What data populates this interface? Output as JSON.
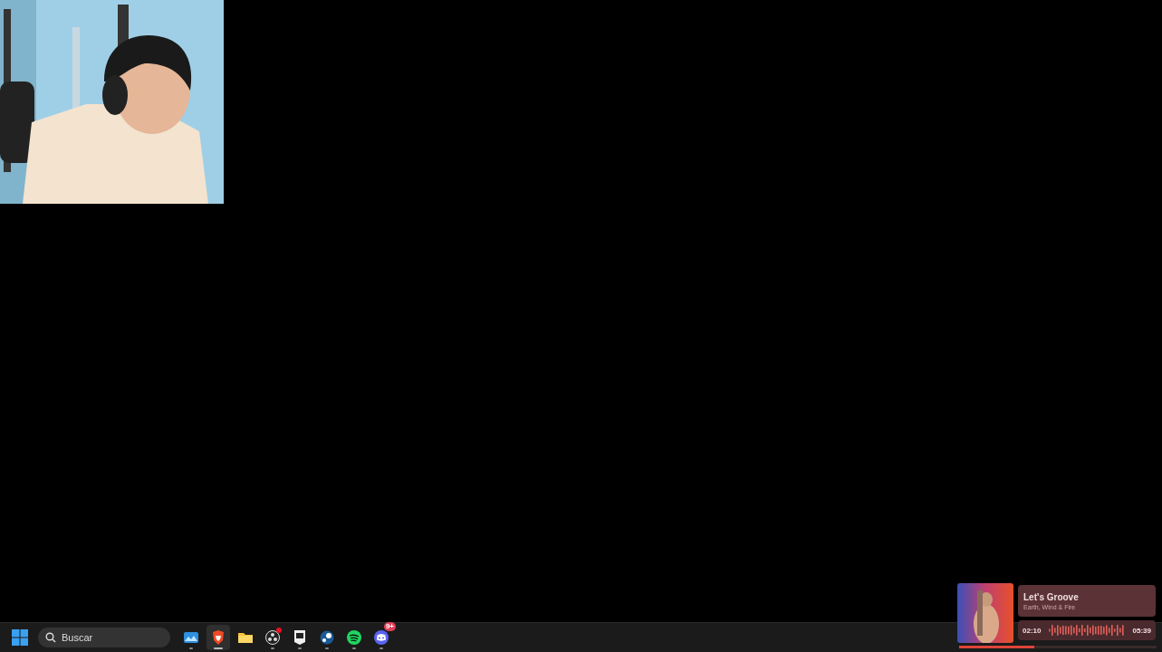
{
  "taskbar": {
    "search": {
      "placeholder": "Buscar"
    },
    "apps": [
      {
        "kind": "photos",
        "selected": false,
        "running": true
      },
      {
        "kind": "browser",
        "selected": true,
        "running": true
      },
      {
        "kind": "folder",
        "selected": false,
        "running": false
      },
      {
        "kind": "obs",
        "selected": false,
        "running": true,
        "badge": {
          "kind": "dot"
        }
      },
      {
        "kind": "epic",
        "selected": false,
        "running": true
      },
      {
        "kind": "steam",
        "selected": false,
        "running": true
      },
      {
        "kind": "spotify",
        "selected": false,
        "running": true
      },
      {
        "kind": "discord",
        "selected": false,
        "running": true,
        "badge": {
          "kind": "count",
          "text": "9+"
        }
      }
    ]
  },
  "now_playing": {
    "title": "Let's Groove",
    "artist": "Earth, Wind & Fire",
    "elapsed": "02:10",
    "duration": "05:39",
    "level": 0.38
  }
}
